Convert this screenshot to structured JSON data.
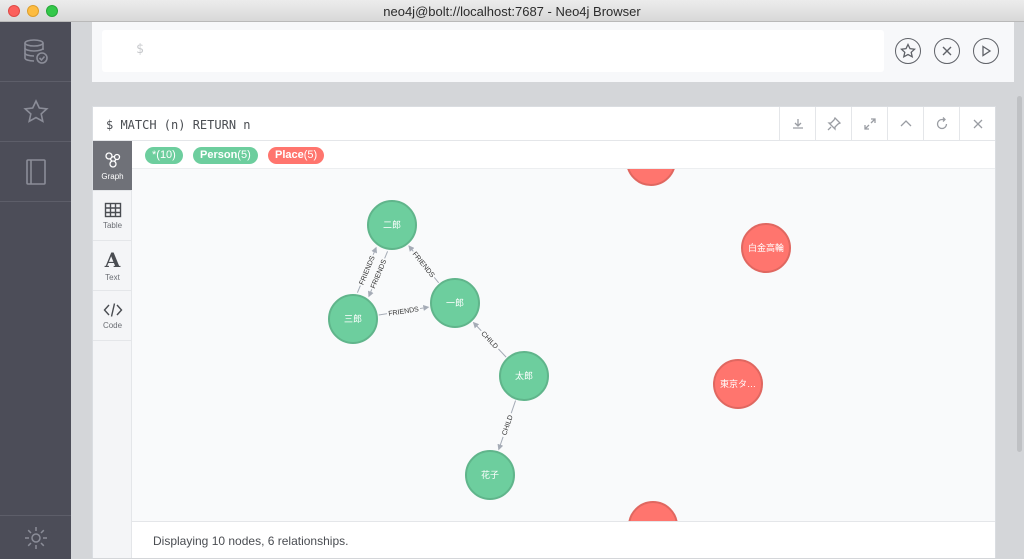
{
  "window": {
    "title": "neo4j@bolt://localhost:7687 - Neo4j Browser"
  },
  "editor": {
    "prompt": "$"
  },
  "frame": {
    "command": "$ MATCH (n) RETURN n",
    "tabs": [
      {
        "label": "Graph",
        "icon": "graph-icon"
      },
      {
        "label": "Table",
        "icon": "table-icon"
      },
      {
        "label": "Text",
        "icon": "text-icon"
      },
      {
        "label": "Code",
        "icon": "code-icon"
      }
    ],
    "legend": [
      {
        "name": "*",
        "count": "(10)",
        "color": "#6dce9e"
      },
      {
        "name": "Person",
        "count": "(5)",
        "color": "#6dce9e"
      },
      {
        "name": "Place",
        "count": "(5)",
        "color": "#ff756e"
      }
    ],
    "status": "Displaying 10 nodes, 6 relationships."
  },
  "graph": {
    "colors": {
      "person": "#6dce9e",
      "person_border": "#60b58b",
      "place": "#ff756e",
      "place_border": "#e06760"
    },
    "nodes": [
      {
        "label": "二郎",
        "type": "person"
      },
      {
        "label": "三郎",
        "type": "person"
      },
      {
        "label": "一郎",
        "type": "person"
      },
      {
        "label": "太郎",
        "type": "person"
      },
      {
        "label": "花子",
        "type": "person"
      },
      {
        "label": "白金高輪",
        "type": "place"
      },
      {
        "label": "東京タ…",
        "type": "place"
      },
      {
        "label": "",
        "type": "place"
      },
      {
        "label": "",
        "type": "place"
      }
    ],
    "relationships": [
      "FRIENDS",
      "FRIENDS",
      "FRIENDS",
      "FRIENDS",
      "CHILD",
      "CHILD"
    ]
  }
}
